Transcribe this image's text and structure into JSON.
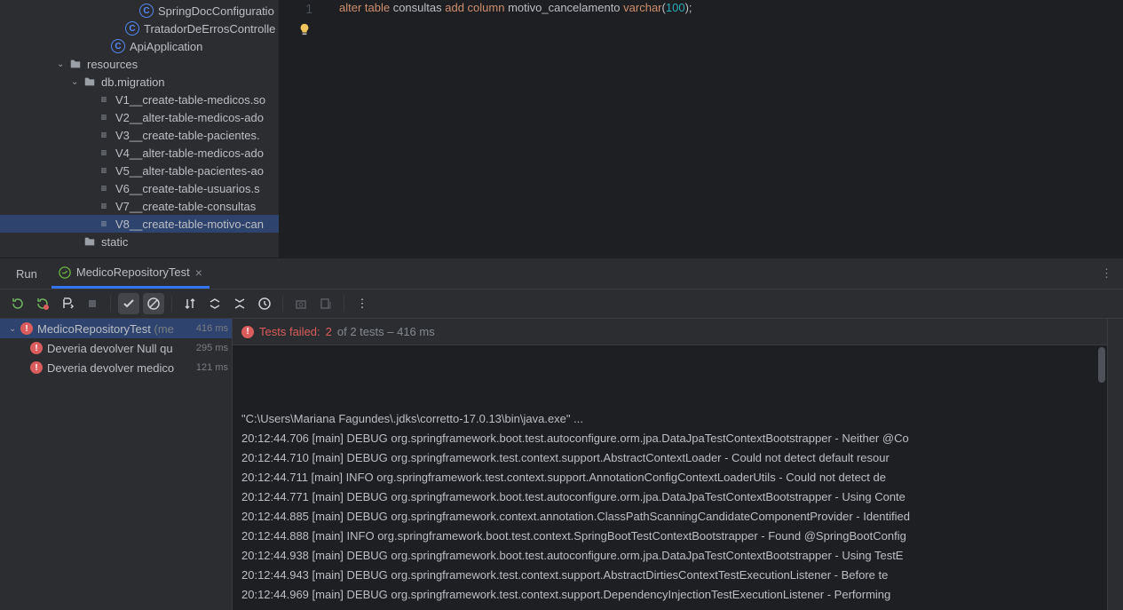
{
  "project_tree": {
    "items": [
      {
        "depth": 9,
        "icon": "cls",
        "label": "SpringDocConfiguratio"
      },
      {
        "depth": 8,
        "icon": "cls",
        "label": "TratadorDeErrosControlle"
      },
      {
        "depth": 7,
        "icon": "cls",
        "label": "ApiApplication"
      },
      {
        "depth": 4,
        "chev": "⌄",
        "icon": "fldr",
        "label": "resources"
      },
      {
        "depth": 5,
        "chev": "⌄",
        "icon": "fldr",
        "label": "db.migration"
      },
      {
        "depth": 6,
        "icon": "sql",
        "label": "V1__create-table-medicos.so"
      },
      {
        "depth": 6,
        "icon": "sql",
        "label": "V2__alter-table-medicos-ado"
      },
      {
        "depth": 6,
        "icon": "sql",
        "label": "V3__create-table-pacientes."
      },
      {
        "depth": 6,
        "icon": "sql",
        "label": "V4__alter-table-medicos-ado"
      },
      {
        "depth": 6,
        "icon": "sql",
        "label": "V5__alter-table-pacientes-ao"
      },
      {
        "depth": 6,
        "icon": "sql",
        "label": "V6__create-table-usuarios.s"
      },
      {
        "depth": 6,
        "icon": "sql",
        "label": "V7__create-table-consultas"
      },
      {
        "depth": 6,
        "icon": "sql",
        "label": "V8__create-table-motivo-can",
        "selected": true
      },
      {
        "depth": 5,
        "icon": "fldr",
        "label": "static"
      }
    ]
  },
  "editor": {
    "line_number": "1",
    "code_tokens": [
      {
        "t": "alter table ",
        "c": "kw"
      },
      {
        "t": "consultas ",
        "c": "fn"
      },
      {
        "t": "add column ",
        "c": "kw"
      },
      {
        "t": "motivo_cancelamento ",
        "c": "fn"
      },
      {
        "t": "varchar",
        "c": "kw"
      },
      {
        "t": "(",
        "c": "fn"
      },
      {
        "t": "100",
        "c": "num"
      },
      {
        "t": ");",
        "c": "fn"
      }
    ]
  },
  "run_panel": {
    "run_label": "Run",
    "tab_label": "MedicoRepositoryTest",
    "header": {
      "prefix": "Tests failed:",
      "count": "2",
      "rest": "of 2 tests – 416 ms"
    },
    "tests": [
      {
        "name": "MedicoRepositoryTest ",
        "dim": "(me",
        "ms": "416 ms",
        "sel": true,
        "chev": "⌄",
        "depth": 0
      },
      {
        "name": "Deveria devolver Null qu",
        "ms": "295 ms",
        "depth": 1
      },
      {
        "name": "Deveria devolver medico",
        "ms": "121 ms",
        "depth": 1
      }
    ],
    "log_lines": [
      "\"C:\\Users\\Mariana Fagundes\\.jdks\\corretto-17.0.13\\bin\\java.exe\" ...",
      "20:12:44.706 [main] DEBUG org.springframework.boot.test.autoconfigure.orm.jpa.DataJpaTestContextBootstrapper - Neither @Co",
      "20:12:44.710 [main] DEBUG org.springframework.test.context.support.AbstractContextLoader - Could not detect default resour",
      "20:12:44.711 [main] INFO org.springframework.test.context.support.AnnotationConfigContextLoaderUtils - Could not detect de",
      "20:12:44.771 [main] DEBUG org.springframework.boot.test.autoconfigure.orm.jpa.DataJpaTestContextBootstrapper - Using Conte",
      "20:12:44.885 [main] DEBUG org.springframework.context.annotation.ClassPathScanningCandidateComponentProvider - Identified ",
      "20:12:44.888 [main] INFO org.springframework.boot.test.context.SpringBootTestContextBootstrapper - Found @SpringBootConfig",
      "20:12:44.938 [main] DEBUG org.springframework.boot.test.autoconfigure.orm.jpa.DataJpaTestContextBootstrapper - Using TestE",
      "20:12:44.943 [main] DEBUG org.springframework.test.context.support.AbstractDirtiesContextTestExecutionListener - Before te",
      "20:12:44.969 [main] DEBUG org.springframework.test.context.support.DependencyInjectionTestExecutionListener - Performing "
    ]
  }
}
